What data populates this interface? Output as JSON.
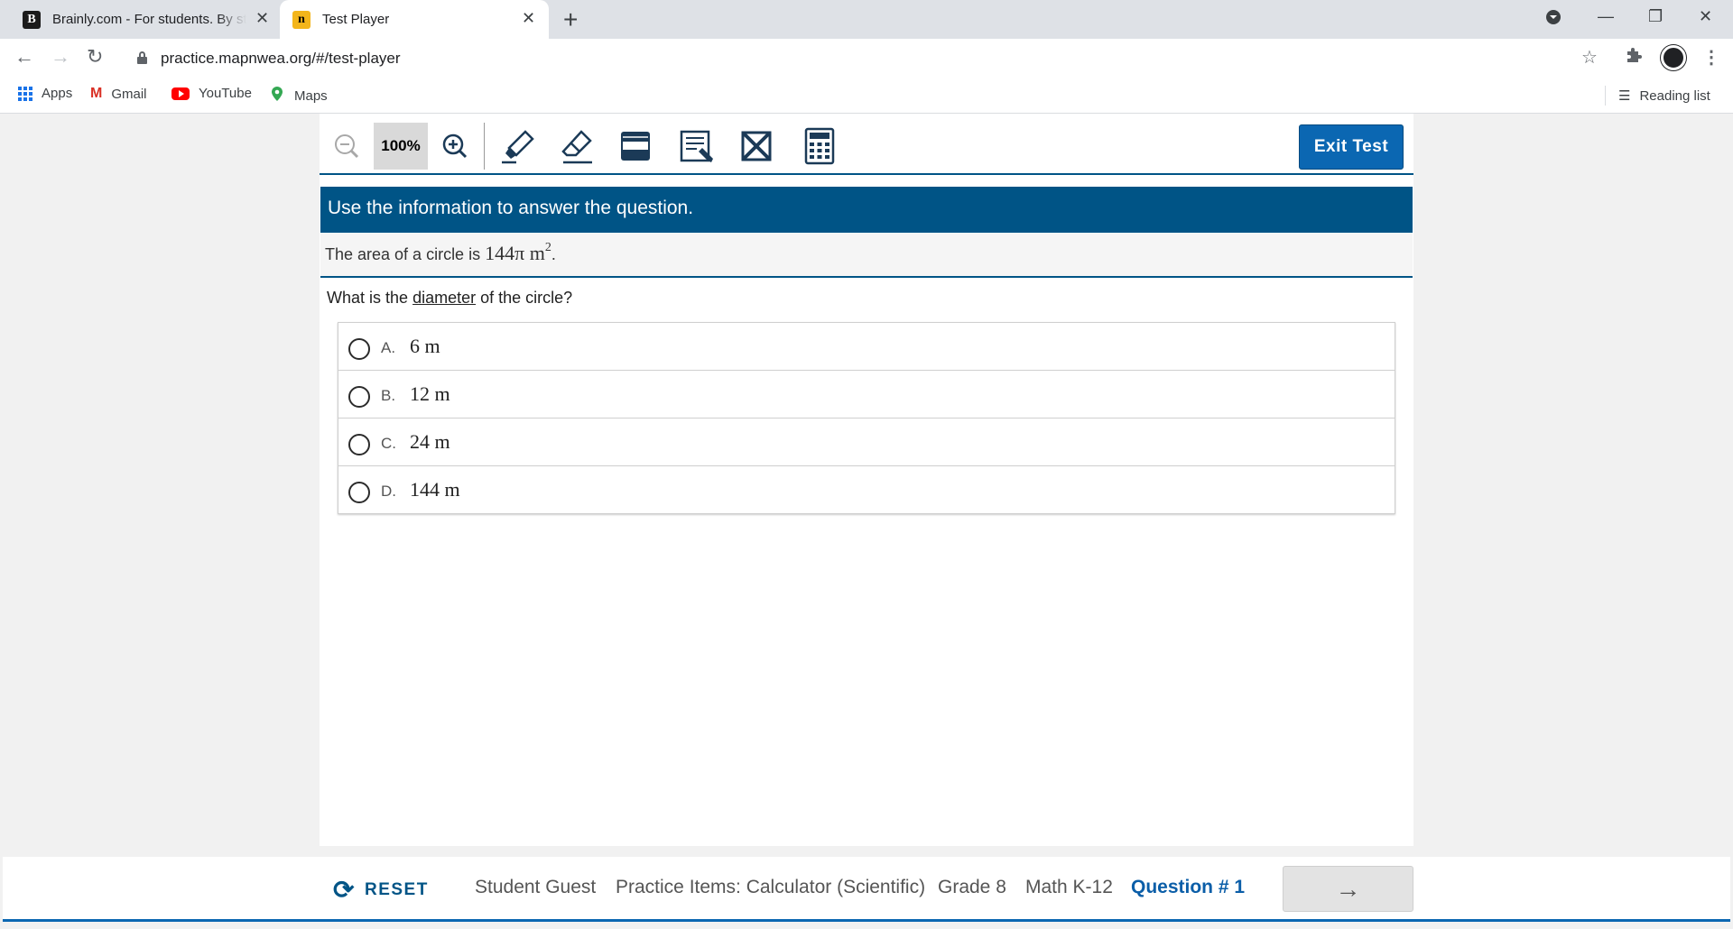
{
  "browser": {
    "tabs": [
      {
        "title": "Brainly.com - For students. By students.",
        "favicon": "B"
      },
      {
        "title": "Test Player",
        "favicon": "n"
      }
    ],
    "url": "practice.mapnwea.org/#/test-player",
    "bookmarks": [
      {
        "label": "Apps"
      },
      {
        "label": "Gmail",
        "icon": "M"
      },
      {
        "label": "YouTube"
      },
      {
        "label": "Maps"
      }
    ],
    "reading_list": "Reading list"
  },
  "player": {
    "zoom": "100%",
    "exit_label": "Exit Test",
    "instruction": "Use the information to answer the question.",
    "stimulus": {
      "prefix": "The area of a circle is",
      "value": "144π m",
      "exponent": "2",
      "suffix": "."
    },
    "question": {
      "before": "What is the",
      "underlined": "diameter",
      "after": "of the circle?"
    },
    "choices": [
      {
        "letter": "A.",
        "text": "6 m"
      },
      {
        "letter": "B.",
        "text": "12 m"
      },
      {
        "letter": "C.",
        "text": "24 m"
      },
      {
        "letter": "D.",
        "text": "144 m"
      }
    ]
  },
  "footer": {
    "reset_label": "RESET",
    "student": "Student Guest",
    "test_name": "Practice Items: Calculator (Scientific)",
    "grade": "Grade 8",
    "subject": "Math K-12",
    "question_number": "Question # 1",
    "next_icon": "→"
  },
  "colors": {
    "brand_dark": "#005486",
    "button_blue": "#0b67b2"
  }
}
